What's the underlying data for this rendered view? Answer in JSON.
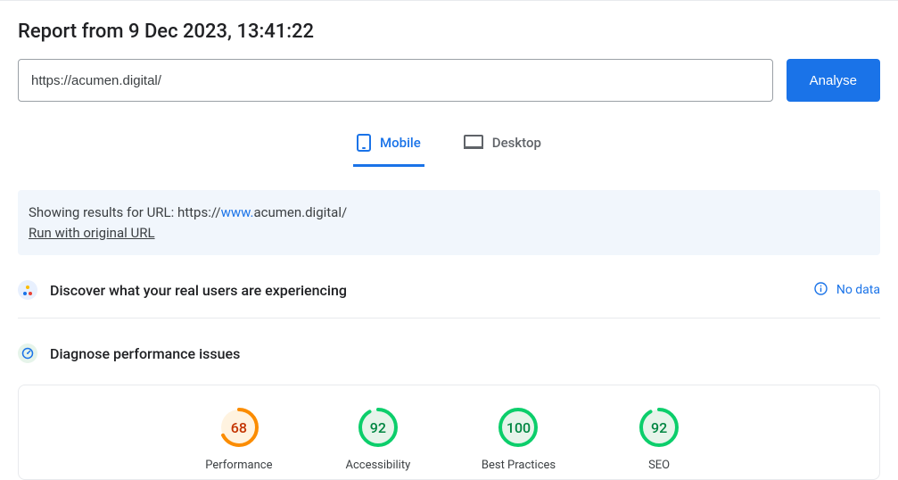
{
  "header": {
    "title": "Report from 9 Dec 2023, 13:41:22"
  },
  "urlbar": {
    "value": "https://acumen.digital/",
    "analyse_label": "Analyse"
  },
  "tabs": {
    "mobile": "Mobile",
    "desktop": "Desktop"
  },
  "banner": {
    "prefix": "Showing results for URL: https://",
    "highlight": "www.",
    "suffix": "acumen.digital/",
    "run_original": "Run with original URL"
  },
  "sections": {
    "discover": "Discover what your real users are experiencing",
    "no_data": "No data",
    "diagnose": "Diagnose performance issues"
  },
  "scores": {
    "performance": {
      "value": "68",
      "label": "Performance"
    },
    "accessibility": {
      "value": "92",
      "label": "Accessibility"
    },
    "best_practices": {
      "value": "100",
      "label": "Best Practices"
    },
    "seo": {
      "value": "92",
      "label": "SEO"
    }
  }
}
